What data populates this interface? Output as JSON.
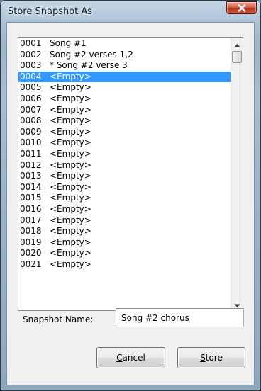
{
  "window": {
    "title": "Store Snapshot As"
  },
  "snapshot_list": {
    "items": [
      {
        "num": "0001",
        "name": "Song #1",
        "selected": false
      },
      {
        "num": "0002",
        "name": "Song #2 verses 1,2",
        "selected": false
      },
      {
        "num": "0003",
        "name": "* Song #2 verse 3",
        "selected": false
      },
      {
        "num": "0004",
        "name": "<Empty>",
        "selected": true
      },
      {
        "num": "0005",
        "name": "<Empty>",
        "selected": false
      },
      {
        "num": "0006",
        "name": "<Empty>",
        "selected": false
      },
      {
        "num": "0007",
        "name": "<Empty>",
        "selected": false
      },
      {
        "num": "0008",
        "name": "<Empty>",
        "selected": false
      },
      {
        "num": "0009",
        "name": "<Empty>",
        "selected": false
      },
      {
        "num": "0010",
        "name": "<Empty>",
        "selected": false
      },
      {
        "num": "0011",
        "name": "<Empty>",
        "selected": false
      },
      {
        "num": "0012",
        "name": "<Empty>",
        "selected": false
      },
      {
        "num": "0013",
        "name": "<Empty>",
        "selected": false
      },
      {
        "num": "0014",
        "name": "<Empty>",
        "selected": false
      },
      {
        "num": "0015",
        "name": "<Empty>",
        "selected": false
      },
      {
        "num": "0016",
        "name": "<Empty>",
        "selected": false
      },
      {
        "num": "0017",
        "name": "<Empty>",
        "selected": false
      },
      {
        "num": "0018",
        "name": "<Empty>",
        "selected": false
      },
      {
        "num": "0019",
        "name": "<Empty>",
        "selected": false
      },
      {
        "num": "0020",
        "name": "<Empty>",
        "selected": false
      },
      {
        "num": "0021",
        "name": "<Empty>",
        "selected": false
      }
    ]
  },
  "snapshot_name": {
    "label": "Snapshot Name:",
    "value": "Song #2 chorus"
  },
  "buttons": {
    "cancel": {
      "accel": "C",
      "rest": "ancel"
    },
    "store": {
      "accel": "S",
      "rest": "tore"
    }
  },
  "icons": {
    "close": "close-icon",
    "scroll_up": "arrow-up-icon",
    "scroll_down": "arrow-down-icon"
  },
  "colors": {
    "selection": "#3399ff",
    "close_button": "#c6452b"
  }
}
